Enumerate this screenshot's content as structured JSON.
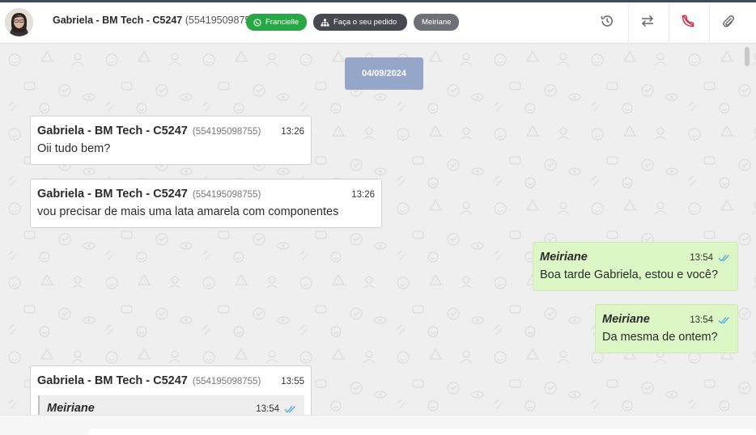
{
  "header": {
    "contact_name": "Gabriela - BM Tech - C5247",
    "contact_phone": "(554195098755)",
    "tags": [
      {
        "label": "Francielle",
        "icon": "whatsapp-icon",
        "color": "#27a745"
      },
      {
        "label": "Faça o seu pedido",
        "icon": "sitemap-icon",
        "color": "#454a50"
      },
      {
        "label": "Meiriane",
        "color": "#6c7178"
      }
    ],
    "actions": [
      {
        "name": "history-icon"
      },
      {
        "name": "transfer-icon"
      },
      {
        "name": "end-call-icon",
        "color": "#d9263f"
      },
      {
        "name": "attach-icon"
      }
    ]
  },
  "chat": {
    "date_label": "04/09/2024",
    "messages": [
      {
        "direction": "in",
        "sender": "Gabriela - BM Tech - C5247",
        "phone": "(554195098755)",
        "time": "13:26",
        "text": "Oii tudo bem?"
      },
      {
        "direction": "in",
        "sender": "Gabriela - BM Tech - C5247",
        "phone": "(554195098755)",
        "time": "13:26",
        "text": "vou precisar de mais uma lata amarela com componentes"
      },
      {
        "direction": "out",
        "sender": "Meiriane",
        "time": "13:54",
        "text": "Boa tarde Gabriela, estou e você?",
        "status": "read"
      },
      {
        "direction": "out",
        "sender": "Meiriane",
        "time": "13:54",
        "text": "Da mesma de ontem?",
        "status": "read"
      },
      {
        "direction": "in",
        "sender": "Gabriela - BM Tech - C5247",
        "phone": "(554195098755)",
        "time": "13:55",
        "quoted": {
          "sender": "Meiriane",
          "time": "13:54",
          "status": "read"
        }
      }
    ]
  },
  "colors": {
    "incoming_bubble": "#ffffff",
    "outgoing_bubble": "#dcf7c5",
    "date_chip": "#96a6c8",
    "read_ticks": "#4fa8e0"
  }
}
